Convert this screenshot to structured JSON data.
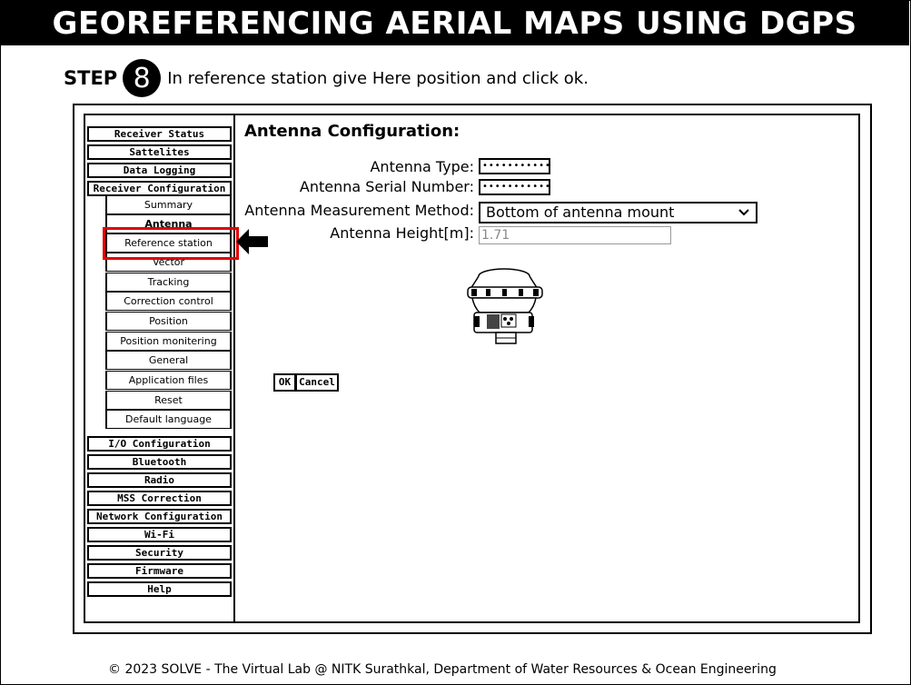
{
  "banner_title": "GEOREFERENCING AERIAL MAPS USING DGPS",
  "step": {
    "label": "STEP",
    "number": "8",
    "instruction": "In reference station give Here position and click ok."
  },
  "sidebar": {
    "main_items": [
      "Receiver Status",
      "Sattelites",
      "Data Logging",
      "Receiver Configuration",
      "I/O Configuration",
      "Bluetooth",
      "Radio",
      "MSS Correction",
      "Network Configuration",
      "Wi-Fi",
      "Security",
      "Firmware",
      "Help"
    ],
    "sub_items": [
      "Summary",
      "Antenna",
      "Reference station",
      "Vector",
      "Tracking",
      "Correction control",
      "Position",
      "Position monitering",
      "General",
      "Application files",
      "Reset",
      "Default language"
    ],
    "active_sub_item": "Antenna",
    "highlighted_item": "Reference station"
  },
  "content": {
    "title": "Antenna Configuration:",
    "fields": {
      "antenna_type_label": "Antenna Type:",
      "antenna_type_value": "•••••••••••",
      "antenna_serial_label": "Antenna Serial Number:",
      "antenna_serial_value": "•••••••••••",
      "measurement_method_label": "Antenna Measurement Method:",
      "measurement_method_value": "Bottom of antenna mount",
      "height_label": "Antenna Height[m]:",
      "height_value": "1.71"
    },
    "ok_label": "OK",
    "cancel_label": "Cancel"
  },
  "footer": "© 2023 SOLVE - The Virtual Lab @ NITK Surathkal, Department of Water Resources & Ocean Engineering",
  "colors": {
    "highlight": "#e00000",
    "banner_bg": "#000000",
    "banner_text": "#ffffff"
  },
  "icons": {
    "pointer_arrow": "arrow-left-icon",
    "select_chevron": "chevron-down-icon",
    "antenna_image": "gnss-antenna-icon"
  }
}
